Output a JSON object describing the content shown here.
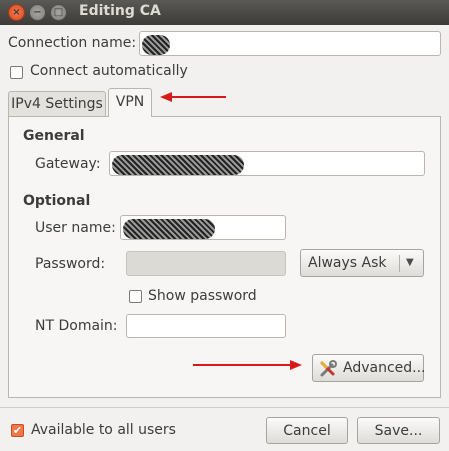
{
  "window": {
    "title": "Editing CA",
    "buttons": {
      "close": "×",
      "minimize": "−",
      "maximize": "□"
    }
  },
  "connection": {
    "name_label": "Connection name:",
    "name_value": "",
    "connect_auto_label": "Connect automatically",
    "connect_auto_checked": false
  },
  "tabs": [
    {
      "label": "IPv4 Settings",
      "active": false
    },
    {
      "label": "VPN",
      "active": true
    }
  ],
  "vpn": {
    "general_heading": "General",
    "gateway_label": "Gateway:",
    "gateway_value": "",
    "optional_heading": "Optional",
    "username_label": "User name:",
    "username_value": "",
    "password_label": "Password:",
    "password_value": "",
    "password_mode": "Always Ask",
    "show_password_label": "Show password",
    "show_password_checked": false,
    "nt_domain_label": "NT Domain:",
    "nt_domain_value": "",
    "advanced_label": "Advanced..."
  },
  "footer": {
    "available_all_label": "Available to all users",
    "available_all_checked": true,
    "cancel_label": "Cancel",
    "save_label": "Save..."
  },
  "annotations": {
    "arrow_color": "#d91a1a"
  },
  "icons": {
    "checkmark": "✔",
    "dropdown": "▼",
    "advanced": "wrench-screwdriver-icon"
  }
}
